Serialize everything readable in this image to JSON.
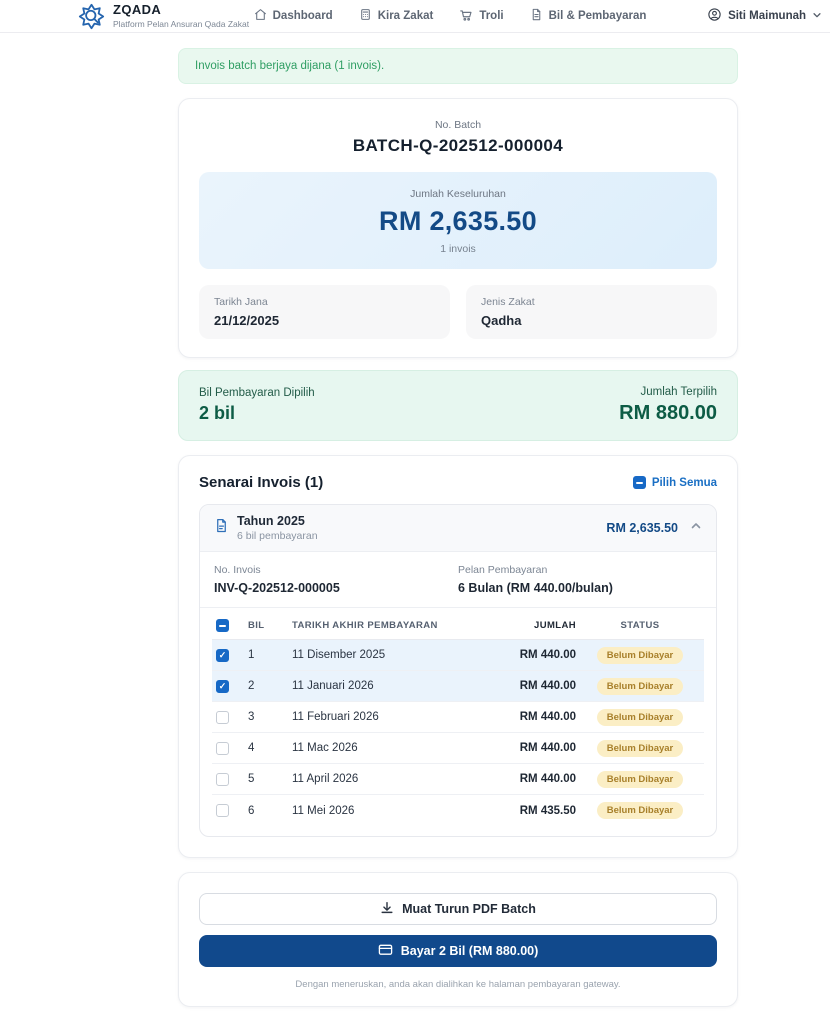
{
  "navbar": {
    "brand": {
      "name": "ZQADA",
      "tagline": "Platform Pelan Ansuran Qada Zakat"
    },
    "items": [
      {
        "label": "Dashboard",
        "icon": "home-icon"
      },
      {
        "label": "Kira Zakat",
        "icon": "calculator-icon"
      },
      {
        "label": "Troli",
        "icon": "cart-icon"
      },
      {
        "label": "Bil & Pembayaran",
        "icon": "document-icon"
      }
    ],
    "user": {
      "name": "Siti Maimunah"
    }
  },
  "alert": {
    "message": "Invois batch berjaya dijana (1 invois)."
  },
  "batch": {
    "no_batch_label": "No. Batch",
    "no_batch": "BATCH-Q-202512-000004",
    "total_label": "Jumlah Keseluruhan",
    "total": "RM 2,635.50",
    "invoice_count": "1 invois",
    "tarikh_jana_label": "Tarikh Jana",
    "tarikh_jana": "21/12/2025",
    "jenis_zakat_label": "Jenis Zakat",
    "jenis_zakat": "Qadha"
  },
  "selection_summary": {
    "bil_label": "Bil Pembayaran Dipilih",
    "bil_value": "2 bil",
    "amount_label": "Jumlah Terpilih",
    "amount_value": "RM 880.00"
  },
  "invoice_list": {
    "title": "Senarai Invois (1)",
    "select_all_label": "Pilih Semua",
    "group": {
      "year_title": "Tahun 2025",
      "subtitle": "6 bil pembayaran",
      "total": "RM 2,635.50",
      "no_invois_label": "No. Invois",
      "no_invois": "INV-Q-202512-000005",
      "pelan_label": "Pelan Pembayaran",
      "pelan": "6 Bulan (RM 440.00/bulan)",
      "table": {
        "col_bil": "BIL",
        "col_date": "TARIKH AKHIR PEMBAYARAN",
        "col_amount": "JUMLAH",
        "col_status": "STATUS",
        "rows": [
          {
            "bil": "1",
            "date": "11 Disember 2025",
            "amount": "RM 440.00",
            "status": "Belum Dibayar",
            "checked": true
          },
          {
            "bil": "2",
            "date": "11 Januari 2026",
            "amount": "RM 440.00",
            "status": "Belum Dibayar",
            "checked": true
          },
          {
            "bil": "3",
            "date": "11 Februari 2026",
            "amount": "RM 440.00",
            "status": "Belum Dibayar",
            "checked": false
          },
          {
            "bil": "4",
            "date": "11 Mac 2026",
            "amount": "RM 440.00",
            "status": "Belum Dibayar",
            "checked": false
          },
          {
            "bil": "5",
            "date": "11 April 2026",
            "amount": "RM 440.00",
            "status": "Belum Dibayar",
            "checked": false
          },
          {
            "bil": "6",
            "date": "11 Mei 2026",
            "amount": "RM 435.50",
            "status": "Belum Dibayar",
            "checked": false
          }
        ]
      }
    }
  },
  "actions": {
    "download_label": "Muat Turun PDF Batch",
    "pay_label": "Bayar 2 Bil (RM 880.00)",
    "disclaimer": "Dengan meneruskan, anda akan dialihkan ke halaman pembayaran gateway."
  },
  "colors": {
    "accent_blue": "#1a6fc4",
    "primary_navy": "#11498c",
    "amount_navy": "#134a86",
    "success_green": "#2f9e63",
    "summary_green": "#0d5c45",
    "badge_bg": "#fbeec5",
    "badge_text": "#a8802b",
    "selected_row_bg": "#eaf3fc"
  }
}
